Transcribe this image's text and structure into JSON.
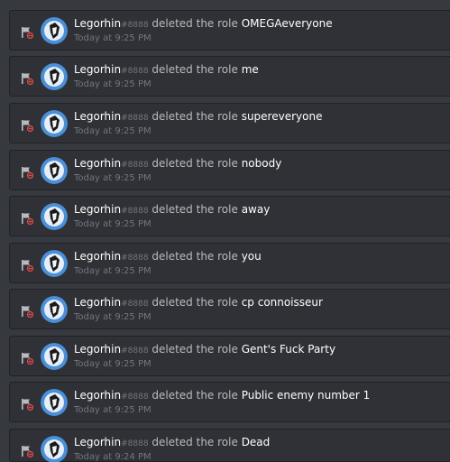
{
  "audit_log": {
    "entries": [
      {
        "user": "Legorhin",
        "discriminator": "#8888",
        "action": "deleted the role",
        "role": "OMEGAeveryone",
        "time": "Today at 9:25 PM"
      },
      {
        "user": "Legorhin",
        "discriminator": "#8888",
        "action": "deleted the role",
        "role": "me",
        "time": "Today at 9:25 PM"
      },
      {
        "user": "Legorhin",
        "discriminator": "#8888",
        "action": "deleted the role",
        "role": "supereveryone",
        "time": "Today at 9:25 PM"
      },
      {
        "user": "Legorhin",
        "discriminator": "#8888",
        "action": "deleted the role",
        "role": "nobody",
        "time": "Today at 9:25 PM"
      },
      {
        "user": "Legorhin",
        "discriminator": "#8888",
        "action": "deleted the role",
        "role": "away",
        "time": "Today at 9:25 PM"
      },
      {
        "user": "Legorhin",
        "discriminator": "#8888",
        "action": "deleted the role",
        "role": "you",
        "time": "Today at 9:25 PM"
      },
      {
        "user": "Legorhin",
        "discriminator": "#8888",
        "action": "deleted the role",
        "role": "cp connoisseur",
        "time": "Today at 9:25 PM"
      },
      {
        "user": "Legorhin",
        "discriminator": "#8888",
        "action": "deleted the role",
        "role": "Gent's Fuck Party",
        "time": "Today at 9:25 PM"
      },
      {
        "user": "Legorhin",
        "discriminator": "#8888",
        "action": "deleted the role",
        "role": "Public enemy number 1",
        "time": "Today at 9:25 PM"
      },
      {
        "user": "Legorhin",
        "discriminator": "#8888",
        "action": "deleted the role",
        "role": "Dead",
        "time": "Today at 9:24 PM"
      }
    ]
  },
  "icons": {
    "action": "role-delete-flag-icon",
    "avatar": "user-avatar"
  },
  "colors": {
    "background": "#36393f",
    "entry_background": "#2f3136",
    "delete_badge": "#f04747",
    "avatar_blue": "#4a90d9"
  }
}
